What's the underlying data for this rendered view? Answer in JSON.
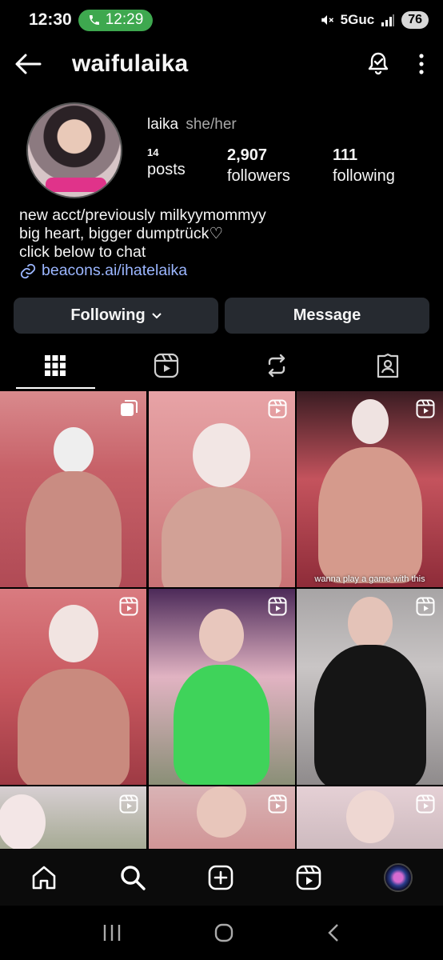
{
  "status_bar": {
    "time": "12:30",
    "call_time": "12:29",
    "network": "5Guc",
    "battery": "76"
  },
  "header": {
    "username": "waifulaika"
  },
  "profile": {
    "name": "laika",
    "pronouns": "she/her",
    "stats": [
      {
        "value": "14",
        "label": "posts"
      },
      {
        "value": "2,907",
        "label": "followers"
      },
      {
        "value": "111",
        "label": "following"
      }
    ],
    "bio": [
      "new acct/previously milkyymommyy",
      "big heart, bigger dumptrück♡",
      "click below to chat"
    ],
    "link": "beacons.ai/ihatelaika"
  },
  "buttons": {
    "following": "Following",
    "message": "Message"
  },
  "tabs": [
    "grid-icon",
    "reels-icon",
    "repost-icon",
    "tagged-icon"
  ],
  "grid": [
    {
      "badge": "carousel-icon",
      "caption": ""
    },
    {
      "badge": "reels-icon",
      "caption": ""
    },
    {
      "badge": "reels-icon",
      "caption": "wanna play a game with this"
    },
    {
      "badge": "reels-icon",
      "caption": ""
    },
    {
      "badge": "reels-icon",
      "caption": ""
    },
    {
      "badge": "reels-icon",
      "caption": ""
    },
    {
      "badge": "reels-icon",
      "caption": ""
    },
    {
      "badge": "reels-icon",
      "caption": ""
    },
    {
      "badge": "reels-icon",
      "caption": ""
    }
  ],
  "bottom_nav": [
    "home-icon",
    "search-icon",
    "create-icon",
    "reels-icon",
    "profile-avatar"
  ],
  "colors": {
    "background": "#000000",
    "button_bg": "#262a30",
    "link": "#9bb6ff",
    "call_pill": "#3ea84f"
  }
}
